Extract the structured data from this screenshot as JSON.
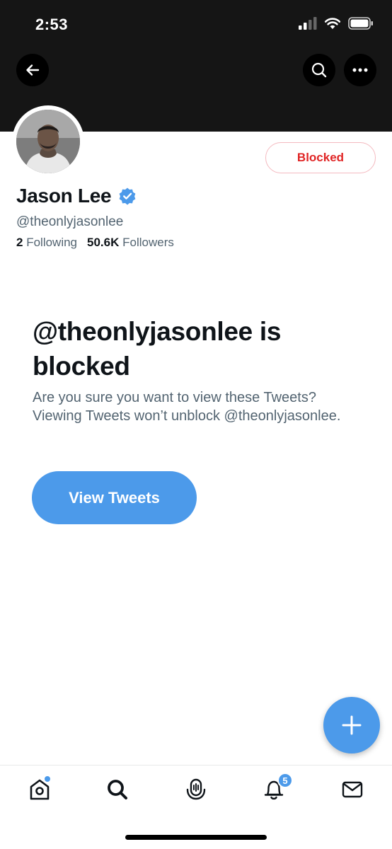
{
  "status_bar": {
    "time": "2:53"
  },
  "profile": {
    "display_name": "Jason Lee",
    "handle": "@theonlyjasonlee",
    "following_count": "2",
    "following_label": "Following",
    "followers_count": "50.6K",
    "followers_label": "Followers",
    "verified": true,
    "blocked_button_label": "Blocked"
  },
  "blocked_notice": {
    "title": "@theonlyjasonlee is blocked",
    "description": "Are you sure you want to view these Tweets? Viewing Tweets won’t unblock @theonlyjasonlee.",
    "view_button_label": "View Tweets"
  },
  "header_actions": [
    "back-icon",
    "search-icon",
    "more-icon"
  ],
  "tab_bar": {
    "tabs": [
      {
        "name": "home",
        "icon": "home-icon",
        "has_dot": true
      },
      {
        "name": "search",
        "icon": "search-icon"
      },
      {
        "name": "spaces",
        "icon": "spaces-icon"
      },
      {
        "name": "notifications",
        "icon": "bell-icon",
        "badge": "5"
      },
      {
        "name": "messages",
        "icon": "mail-icon"
      }
    ]
  },
  "colors": {
    "accent": "#4c9aea",
    "blocked_red": "#e02525",
    "text_primary": "#0f1419",
    "text_secondary": "#536471",
    "banner": "#151515"
  }
}
